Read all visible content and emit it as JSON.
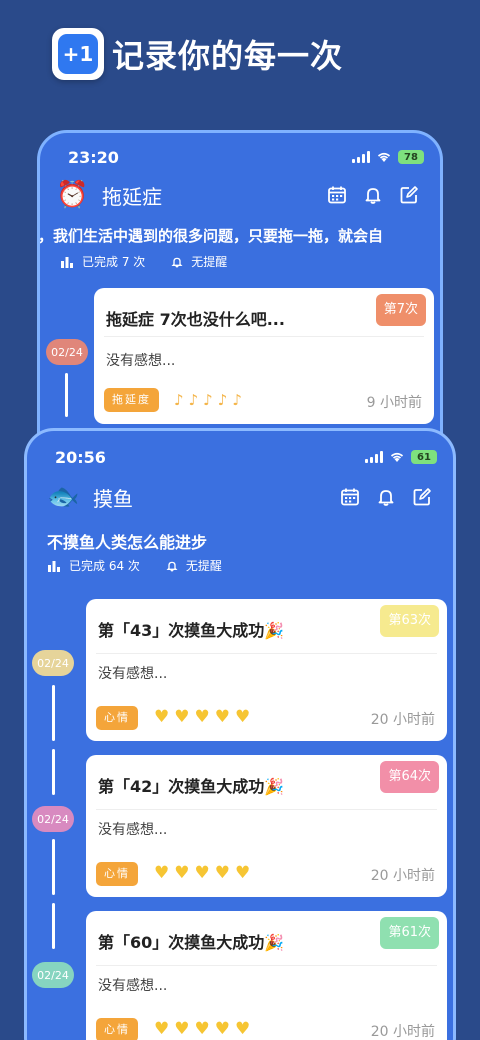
{
  "banner": {
    "icon_text": "+1",
    "title": "记录你的每一次"
  },
  "back_phone": {
    "time": "23:20",
    "battery": "78",
    "app_icon": "⏰",
    "app_name": "拖延症",
    "motto": "，我们生活中遇到的很多问题，只要拖一拖，就会自",
    "completed": "已完成 7 次",
    "reminder": "无提醒",
    "date": "02/24",
    "date_color": "#e0867a",
    "card": {
      "title": "拖延症 7次也没什么吧...",
      "rank": "第7次",
      "rank_color": "#ef8f6a",
      "note": "没有感想...",
      "tag": "拖延度",
      "icon_glyph": "♪",
      "icons_count": 5,
      "ago": "9 小时前"
    }
  },
  "front_phone": {
    "time": "20:56",
    "battery": "61",
    "app_icon": "🐟",
    "app_name": "摸鱼",
    "motto": "不摸鱼人类怎么能进步",
    "completed": "已完成 64 次",
    "reminder": "无提醒",
    "cards": [
      {
        "title": "第「43」次摸鱼大成功🎉",
        "rank": "第63次",
        "rank_color": "#f6ea8f",
        "date": "02/24",
        "date_color": "#e6d49a",
        "note": "没有感想...",
        "tag": "心情",
        "ago": "20 小时前"
      },
      {
        "title": "第「42」次摸鱼大成功🎉",
        "rank": "第64次",
        "rank_color": "#f28fa8",
        "date": "02/24",
        "date_color": "#d88ac0",
        "note": "没有感想...",
        "tag": "心情",
        "ago": "20 小时前"
      },
      {
        "title": "第「60」次摸鱼大成功🎉",
        "rank": "第61次",
        "rank_color": "#8fe0b0",
        "date": "02/24",
        "date_color": "#86d4c0",
        "note": "没有感想...",
        "tag": "心情",
        "ago": "20 小时前"
      }
    ],
    "heart_glyph": "♥",
    "hearts_count": 5
  },
  "colors": {
    "background": "#2a4a8a",
    "phone": "#3a6fdf",
    "accent_tag": "#f4a53a",
    "hearts": "#f6c533"
  }
}
